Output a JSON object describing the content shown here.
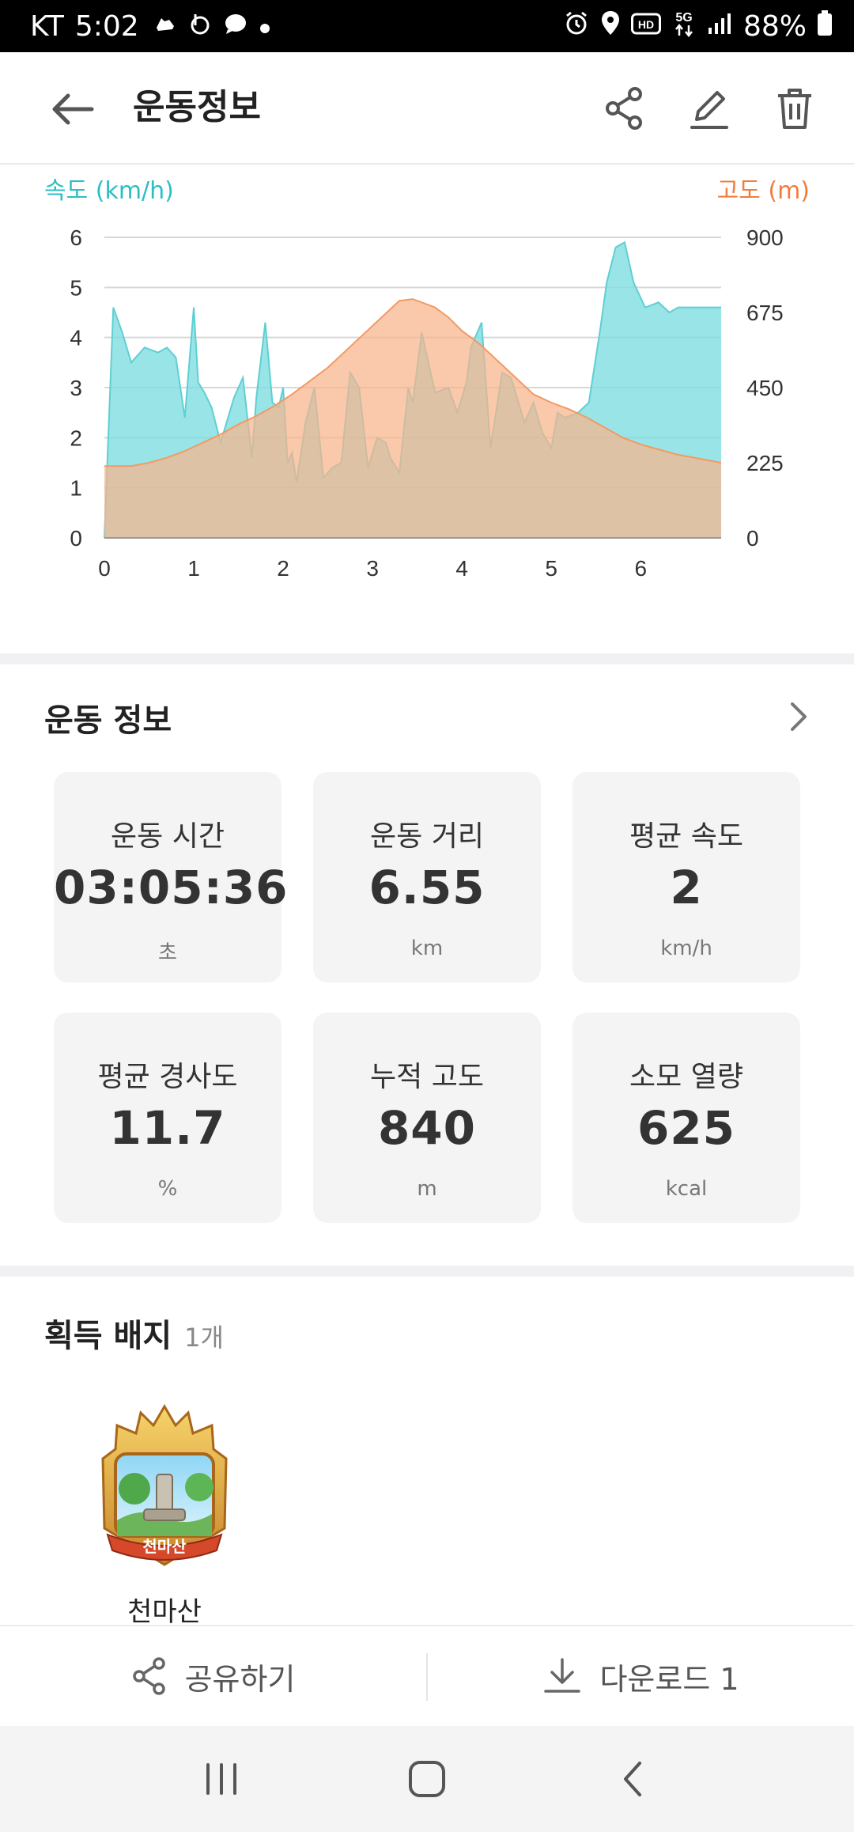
{
  "status_bar": {
    "carrier": "KT",
    "time": "5:02",
    "battery": "88%"
  },
  "app_bar": {
    "title": "운동정보"
  },
  "chart": {
    "left_axis_title": "속도 (km/h)",
    "right_axis_title": "고도 (m)",
    "speed_color": "#7fdde0",
    "altitude_color": "#f8b48c"
  },
  "chart_data": {
    "type": "area",
    "x_ticks": [
      "0",
      "1",
      "2",
      "3",
      "4",
      "5",
      "6"
    ],
    "left_ticks": [
      "0",
      "1",
      "2",
      "3",
      "4",
      "5",
      "6"
    ],
    "right_ticks": [
      "0",
      "225",
      "450",
      "675",
      "900"
    ],
    "xlim": [
      0,
      6.9
    ],
    "ylim_left": [
      0,
      6
    ],
    "ylim_right": [
      0,
      900
    ],
    "grid": true,
    "series": [
      {
        "axis": "left",
        "x": [
          0,
          0.1,
          0.2,
          0.3,
          0.45,
          0.6,
          0.7,
          0.8,
          0.9,
          1.0,
          1.05,
          1.12,
          1.2,
          1.3,
          1.45,
          1.55,
          1.65,
          1.7,
          1.8,
          1.88,
          1.95,
          2.0,
          2.05,
          2.1,
          2.15,
          2.25,
          2.35,
          2.45,
          2.55,
          2.65,
          2.75,
          2.85,
          2.95,
          3.05,
          3.15,
          3.2,
          3.3,
          3.4,
          3.45,
          3.55,
          3.7,
          3.85,
          3.95,
          4.05,
          4.1,
          4.22,
          4.32,
          4.45,
          4.55,
          4.7,
          4.8,
          4.9,
          5.0,
          5.07,
          5.15,
          5.3,
          5.42,
          5.55,
          5.62,
          5.72,
          5.82,
          5.92,
          6.05,
          6.2,
          6.32,
          6.42,
          6.5,
          6.6,
          6.7,
          6.8,
          6.9
        ],
        "values": [
          0,
          4.6,
          4.1,
          3.5,
          3.8,
          3.7,
          3.8,
          3.6,
          2.4,
          4.6,
          3.1,
          2.9,
          2.6,
          1.9,
          2.8,
          3.2,
          1.6,
          2.8,
          4.3,
          2.7,
          2.6,
          3.0,
          1.5,
          1.7,
          1.1,
          2.3,
          3.0,
          1.2,
          1.4,
          1.5,
          3.3,
          3.0,
          1.4,
          2.0,
          1.9,
          1.6,
          1.3,
          3.0,
          2.7,
          4.1,
          2.9,
          3.0,
          2.5,
          3.1,
          3.8,
          4.3,
          1.8,
          3.3,
          3.2,
          2.3,
          2.7,
          2.1,
          1.8,
          2.5,
          2.4,
          2.5,
          2.7,
          4.2,
          5.1,
          5.8,
          5.9,
          5.1,
          4.6,
          4.7,
          4.5,
          4.6,
          4.6,
          4.6,
          4.6,
          4.6,
          4.6
        ],
        "name": "속도 (km/h)"
      },
      {
        "axis": "right",
        "x": [
          0,
          0.3,
          0.5,
          0.7,
          0.9,
          1.1,
          1.3,
          1.5,
          1.7,
          1.9,
          2.1,
          2.3,
          2.5,
          2.7,
          2.9,
          3.1,
          3.3,
          3.45,
          3.55,
          3.7,
          3.85,
          4.0,
          4.2,
          4.4,
          4.6,
          4.8,
          5.0,
          5.2,
          5.4,
          5.6,
          5.8,
          6.0,
          6.2,
          6.4,
          6.6,
          6.8,
          6.9
        ],
        "values": [
          215,
          215,
          225,
          240,
          260,
          285,
          310,
          340,
          365,
          395,
          430,
          470,
          510,
          560,
          610,
          660,
          710,
          715,
          705,
          690,
          660,
          620,
          580,
          530,
          480,
          430,
          405,
          385,
          360,
          330,
          300,
          280,
          265,
          250,
          240,
          230,
          225
        ],
        "name": "고도 (m)"
      }
    ]
  },
  "workout_info": {
    "title": "운동 정보",
    "stats": [
      {
        "label": "운동 시간",
        "value": "03:05:36",
        "unit": "초"
      },
      {
        "label": "운동 거리",
        "value": "6.55",
        "unit": "km"
      },
      {
        "label": "평균 속도",
        "value": "2",
        "unit": "km/h"
      },
      {
        "label": "평균 경사도",
        "value": "11.7",
        "unit": "%"
      },
      {
        "label": "누적 고도",
        "value": "840",
        "unit": "m"
      },
      {
        "label": "소모 열량",
        "value": "625",
        "unit": "kcal"
      }
    ]
  },
  "badges": {
    "title": "획득 배지",
    "count": "1개",
    "items": [
      {
        "name": "천마산",
        "emblem_text": "천마산"
      }
    ]
  },
  "bottom_actions": {
    "share_label": "공유하기",
    "download_label": "다운로드 1"
  }
}
